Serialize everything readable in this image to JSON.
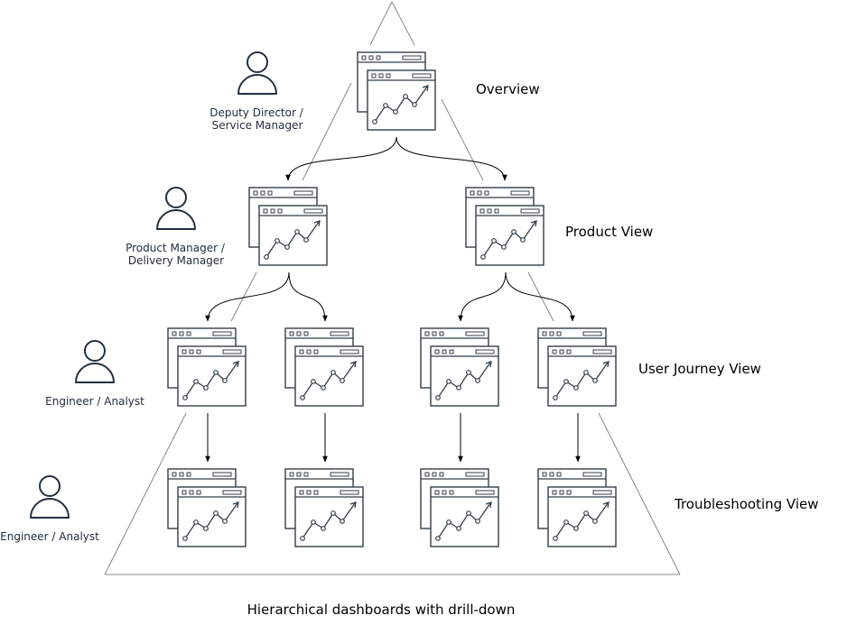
{
  "caption": "Hierarchical dashboards with drill-down",
  "levels": [
    {
      "label": "Overview"
    },
    {
      "label": "Product View"
    },
    {
      "label": "User Journey View"
    },
    {
      "label": "Troubleshooting View"
    }
  ],
  "roles": [
    {
      "line1": "Deputy Director /",
      "line2": "Service Manager"
    },
    {
      "line1": "Product Manager /",
      "line2": "Delivery Manager"
    },
    {
      "line1": "Engineer / Analyst",
      "line2": ""
    },
    {
      "line1": "Engineer / Analyst",
      "line2": ""
    }
  ],
  "icons": {
    "dashboard": "dashboard-icon",
    "person": "person-icon"
  },
  "colors": {
    "icon": "#333f48",
    "person": "#232f3e",
    "pyramid": "#888888"
  }
}
